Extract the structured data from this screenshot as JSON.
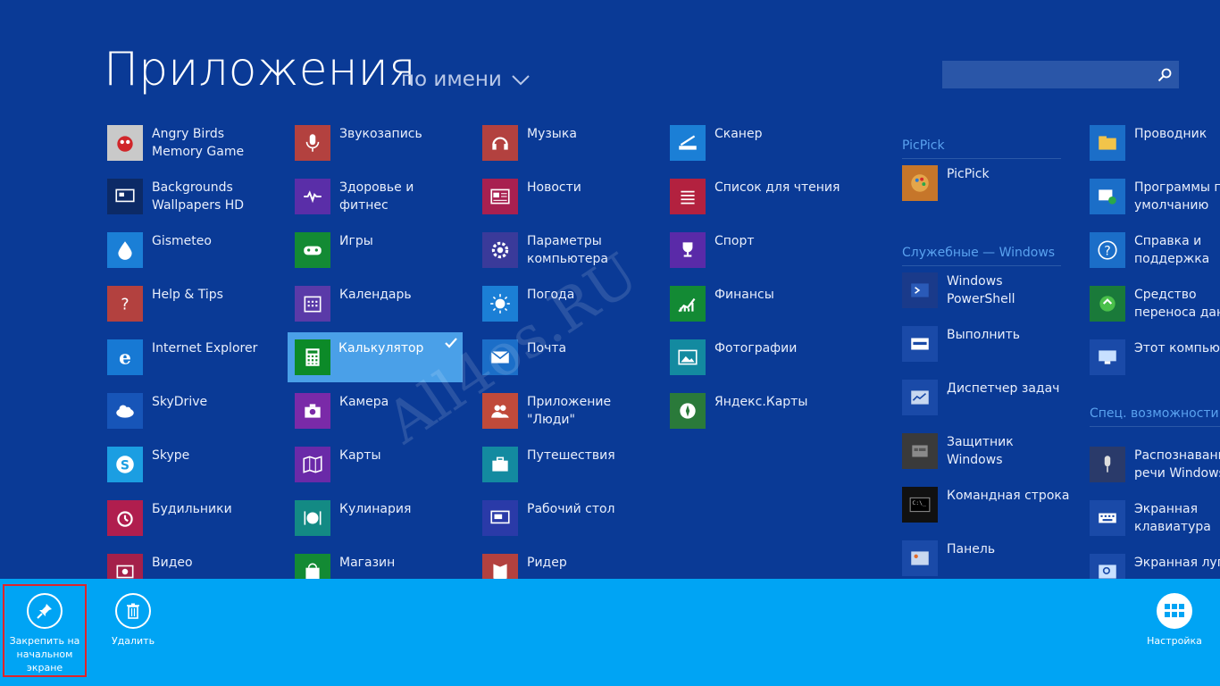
{
  "header": {
    "title": "Приложения",
    "sort_label": "по имени"
  },
  "search": {
    "placeholder": ""
  },
  "watermark": "All4os.RU",
  "columns": [
    {
      "items": [
        {
          "label": "Angry Birds\nMemory Game",
          "icon": "angry-bird-icon",
          "color": "#c9c9c9"
        },
        {
          "label": "Backgrounds\nWallpapers HD",
          "icon": "wallpaper-icon",
          "color": "#0c2a66"
        },
        {
          "label": "Gismeteo",
          "icon": "water-drop-icon",
          "color": "#1b7fd6"
        },
        {
          "label": "Help & Tips",
          "icon": "question-icon",
          "color": "#b3413f"
        },
        {
          "label": "Internet Explorer",
          "icon": "internet-explorer-icon",
          "color": "#1779d4"
        },
        {
          "label": "SkyDrive",
          "icon": "cloud-icon",
          "color": "#1755b8"
        },
        {
          "label": "Skype",
          "icon": "skype-icon",
          "color": "#1b9ee2"
        },
        {
          "label": "Будильники",
          "icon": "alarm-clock-icon",
          "color": "#b01e4e"
        },
        {
          "label": "Видео",
          "icon": "video-icon",
          "color": "#a4204a"
        }
      ]
    },
    {
      "items": [
        {
          "label": "Звукозапись",
          "icon": "microphone-icon",
          "color": "#b3413f"
        },
        {
          "label": "Здоровье и\nфитнес",
          "icon": "heart-icon",
          "color": "#5a2ea8"
        },
        {
          "label": "Игры",
          "icon": "gamepad-icon",
          "color": "#138a34"
        },
        {
          "label": "Календарь",
          "icon": "calendar-icon",
          "color": "#5a3aa8"
        },
        {
          "label": "Калькулятор",
          "icon": "calculator-icon",
          "color": "#0c8a28",
          "selected": true
        },
        {
          "label": "Камера",
          "icon": "camera-icon",
          "color": "#7a2aa8"
        },
        {
          "label": "Карты",
          "icon": "map-icon",
          "color": "#6a2aa8"
        },
        {
          "label": "Кулинария",
          "icon": "plate-icon",
          "color": "#138a84"
        },
        {
          "label": "Магазин",
          "icon": "store-icon",
          "color": "#138a34"
        }
      ]
    },
    {
      "items": [
        {
          "label": "Музыка",
          "icon": "headphones-icon",
          "color": "#b3413f"
        },
        {
          "label": "Новости",
          "icon": "news-icon",
          "color": "#a82050"
        },
        {
          "label": "Параметры\nкомпьютера",
          "icon": "gear-icon",
          "color": "#3a3a9a"
        },
        {
          "label": "Погода",
          "icon": "sun-icon",
          "color": "#1b7fd6"
        },
        {
          "label": "Почта",
          "icon": "mail-icon",
          "color": "#1b6ec8"
        },
        {
          "label": "Приложение\n\"Люди\"",
          "icon": "people-icon",
          "color": "#c04a3a"
        },
        {
          "label": "Путешествия",
          "icon": "suitcase-icon",
          "color": "#138aa0"
        },
        {
          "label": "Рабочий стол",
          "icon": "desktop-icon",
          "color": "#2a3aa8"
        },
        {
          "label": "Ридер",
          "icon": "reader-icon",
          "color": "#b3413f"
        }
      ]
    },
    {
      "items": [
        {
          "label": "Сканер",
          "icon": "scanner-icon",
          "color": "#1b7fd6"
        },
        {
          "label": "Список для чтения",
          "icon": "list-icon",
          "color": "#b3213f"
        },
        {
          "label": "Спорт",
          "icon": "trophy-icon",
          "color": "#5a2aa8"
        },
        {
          "label": "Финансы",
          "icon": "chart-up-icon",
          "color": "#138a34"
        },
        {
          "label": "Фотографии",
          "icon": "photo-icon",
          "color": "#138aa0"
        },
        {
          "label": "Яндекс.Карты",
          "icon": "compass-icon",
          "color": "#2a7a3a"
        }
      ]
    }
  ],
  "groups": [
    {
      "header": "PicPick",
      "items": [
        {
          "label": "PicPick",
          "icon": "palette-icon",
          "color": "#c6762a"
        }
      ]
    },
    {
      "header": "Служебные — Windows",
      "items": [
        {
          "label": "Windows\nPowerShell",
          "icon": "powershell-icon",
          "color": "#1a3a8a"
        },
        {
          "label": "Выполнить",
          "icon": "run-icon",
          "color": "#1a4aa8"
        },
        {
          "label": "Диспетчер задач",
          "icon": "task-manager-icon",
          "color": "#1a4aa8"
        },
        {
          "label": "Защитник\nWindows",
          "icon": "defender-icon",
          "color": "#3a3a3a"
        },
        {
          "label": "Командная строка",
          "icon": "cmd-icon",
          "color": "#111111"
        },
        {
          "label": "Панель",
          "icon": "control-panel-icon",
          "color": "#1a4aa8"
        }
      ]
    }
  ],
  "last_column": {
    "items": [
      {
        "label": "Проводник",
        "icon": "folder-icon",
        "color": "#1b6ec8"
      },
      {
        "label": "Программы по\nумолчанию",
        "icon": "default-programs-icon",
        "color": "#1b6ec8"
      },
      {
        "label": "Справка и\nподдержка",
        "icon": "help-icon",
        "color": "#1b6ec8"
      },
      {
        "label": "Средство\nпереноса данн",
        "icon": "transfer-icon",
        "color": "#1a7a3a"
      },
      {
        "label": "Этот компьюте",
        "icon": "computer-icon",
        "color": "#1a4aa8"
      }
    ],
    "group_header": "Спец. возможности",
    "group_items": [
      {
        "label": "Распознавание\nречи Windows",
        "icon": "speech-microphone-icon",
        "color": "#2a3a6a"
      },
      {
        "label": "Экранная\nклавиатура",
        "icon": "keyboard-icon",
        "color": "#1a4aa8"
      },
      {
        "label": "Экранная лупа",
        "icon": "magnifier-icon",
        "color": "#1a4aa8"
      }
    ]
  },
  "appbar": {
    "pin_label": "Закрепить на начальном экране",
    "delete_label": "Удалить",
    "customize_label": "Настройка"
  }
}
